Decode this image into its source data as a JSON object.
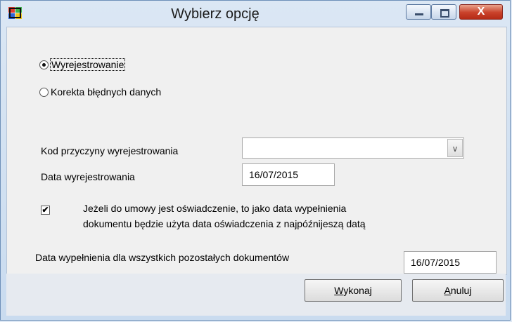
{
  "window": {
    "title": "Wybierz opcję",
    "close_glyph": "X",
    "app_icon": "app-icon"
  },
  "options": {
    "opt1": "Wyrejestrowanie",
    "opt2": "Korekta błędnych danych",
    "selected": "Wyrejestrowanie"
  },
  "form": {
    "reason_label": "Kod przyczyny wyrejestrowania",
    "reason_value": "",
    "date_label": "Data wyrejestrowania",
    "date_value": "16/07/2015",
    "checkbox_checked": true,
    "checkbox_line1": "Jeżeli do umowy jest oświadczenie, to jako data wypełnienia",
    "checkbox_line2": "dokumentu będzie użyta data oświadczenia z najpóźnijeszą datą",
    "fill_label": "Data wypełnienia dla wszystkich pozostałych dokumentów",
    "fill_value": "16/07/2015"
  },
  "buttons": {
    "execute_first": "W",
    "execute_rest": "ykonaj",
    "cancel_first": "A",
    "cancel_rest": "nuluj"
  }
}
